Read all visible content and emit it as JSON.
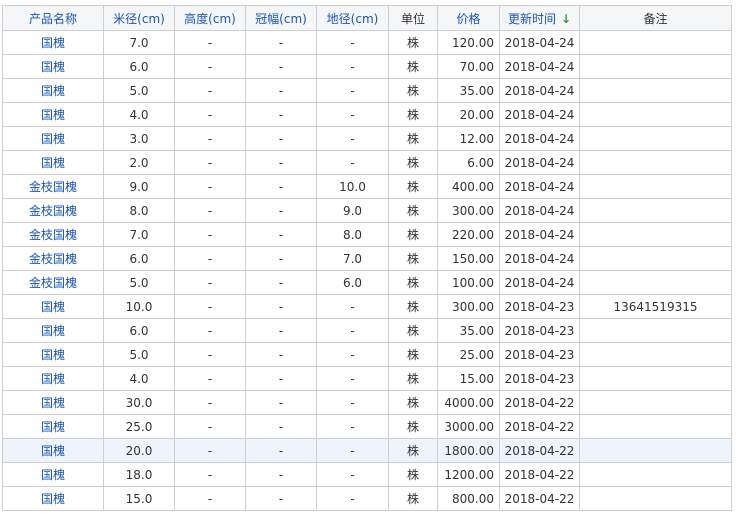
{
  "headers": [
    {
      "label": "产品名称",
      "kind": "link"
    },
    {
      "label": "米径(cm)",
      "kind": "link"
    },
    {
      "label": "高度(cm)",
      "kind": "link"
    },
    {
      "label": "冠幅(cm)",
      "kind": "link"
    },
    {
      "label": "地径(cm)",
      "kind": "link"
    },
    {
      "label": "单位",
      "kind": "plain"
    },
    {
      "label": "价格",
      "kind": "link"
    },
    {
      "label": "更新时间",
      "kind": "link",
      "sort_icon": "sort-down-arrow-icon",
      "sort_glyph": "↓"
    },
    {
      "label": "备注",
      "kind": "plain"
    }
  ],
  "colors": {
    "link_text": "#1a55b5",
    "border": "#cfcfcf",
    "header_bg": "#f4f6f8",
    "highlight_row_bg": "#eef4fc",
    "sort_arrow": "#2f9e41"
  },
  "rows": [
    {
      "name": "国槐",
      "mijing": "7.0",
      "height": "-",
      "crown": "-",
      "dijing": "-",
      "unit": "株",
      "price": "120.00",
      "date": "2018-04-24",
      "note": ""
    },
    {
      "name": "国槐",
      "mijing": "6.0",
      "height": "-",
      "crown": "-",
      "dijing": "-",
      "unit": "株",
      "price": "70.00",
      "date": "2018-04-24",
      "note": ""
    },
    {
      "name": "国槐",
      "mijing": "5.0",
      "height": "-",
      "crown": "-",
      "dijing": "-",
      "unit": "株",
      "price": "35.00",
      "date": "2018-04-24",
      "note": ""
    },
    {
      "name": "国槐",
      "mijing": "4.0",
      "height": "-",
      "crown": "-",
      "dijing": "-",
      "unit": "株",
      "price": "20.00",
      "date": "2018-04-24",
      "note": ""
    },
    {
      "name": "国槐",
      "mijing": "3.0",
      "height": "-",
      "crown": "-",
      "dijing": "-",
      "unit": "株",
      "price": "12.00",
      "date": "2018-04-24",
      "note": ""
    },
    {
      "name": "国槐",
      "mijing": "2.0",
      "height": "-",
      "crown": "-",
      "dijing": "-",
      "unit": "株",
      "price": "6.00",
      "date": "2018-04-24",
      "note": ""
    },
    {
      "name": "金枝国槐",
      "mijing": "9.0",
      "height": "-",
      "crown": "-",
      "dijing": "10.0",
      "unit": "株",
      "price": "400.00",
      "date": "2018-04-24",
      "note": ""
    },
    {
      "name": "金枝国槐",
      "mijing": "8.0",
      "height": "-",
      "crown": "-",
      "dijing": "9.0",
      "unit": "株",
      "price": "300.00",
      "date": "2018-04-24",
      "note": ""
    },
    {
      "name": "金枝国槐",
      "mijing": "7.0",
      "height": "-",
      "crown": "-",
      "dijing": "8.0",
      "unit": "株",
      "price": "220.00",
      "date": "2018-04-24",
      "note": ""
    },
    {
      "name": "金枝国槐",
      "mijing": "6.0",
      "height": "-",
      "crown": "-",
      "dijing": "7.0",
      "unit": "株",
      "price": "150.00",
      "date": "2018-04-24",
      "note": ""
    },
    {
      "name": "金枝国槐",
      "mijing": "5.0",
      "height": "-",
      "crown": "-",
      "dijing": "6.0",
      "unit": "株",
      "price": "100.00",
      "date": "2018-04-24",
      "note": ""
    },
    {
      "name": "国槐",
      "mijing": "10.0",
      "height": "-",
      "crown": "-",
      "dijing": "-",
      "unit": "株",
      "price": "300.00",
      "date": "2018-04-23",
      "note": "13641519315"
    },
    {
      "name": "国槐",
      "mijing": "6.0",
      "height": "-",
      "crown": "-",
      "dijing": "-",
      "unit": "株",
      "price": "35.00",
      "date": "2018-04-23",
      "note": ""
    },
    {
      "name": "国槐",
      "mijing": "5.0",
      "height": "-",
      "crown": "-",
      "dijing": "-",
      "unit": "株",
      "price": "25.00",
      "date": "2018-04-23",
      "note": ""
    },
    {
      "name": "国槐",
      "mijing": "4.0",
      "height": "-",
      "crown": "-",
      "dijing": "-",
      "unit": "株",
      "price": "15.00",
      "date": "2018-04-23",
      "note": ""
    },
    {
      "name": "国槐",
      "mijing": "30.0",
      "height": "-",
      "crown": "-",
      "dijing": "-",
      "unit": "株",
      "price": "4000.00",
      "date": "2018-04-22",
      "note": ""
    },
    {
      "name": "国槐",
      "mijing": "25.0",
      "height": "-",
      "crown": "-",
      "dijing": "-",
      "unit": "株",
      "price": "3000.00",
      "date": "2018-04-22",
      "note": ""
    },
    {
      "name": "国槐",
      "mijing": "20.0",
      "height": "-",
      "crown": "-",
      "dijing": "-",
      "unit": "株",
      "price": "1800.00",
      "date": "2018-04-22",
      "note": "",
      "highlighted": true
    },
    {
      "name": "国槐",
      "mijing": "18.0",
      "height": "-",
      "crown": "-",
      "dijing": "-",
      "unit": "株",
      "price": "1200.00",
      "date": "2018-04-22",
      "note": ""
    },
    {
      "name": "国槐",
      "mijing": "15.0",
      "height": "-",
      "crown": "-",
      "dijing": "-",
      "unit": "株",
      "price": "800.00",
      "date": "2018-04-22",
      "note": ""
    }
  ]
}
